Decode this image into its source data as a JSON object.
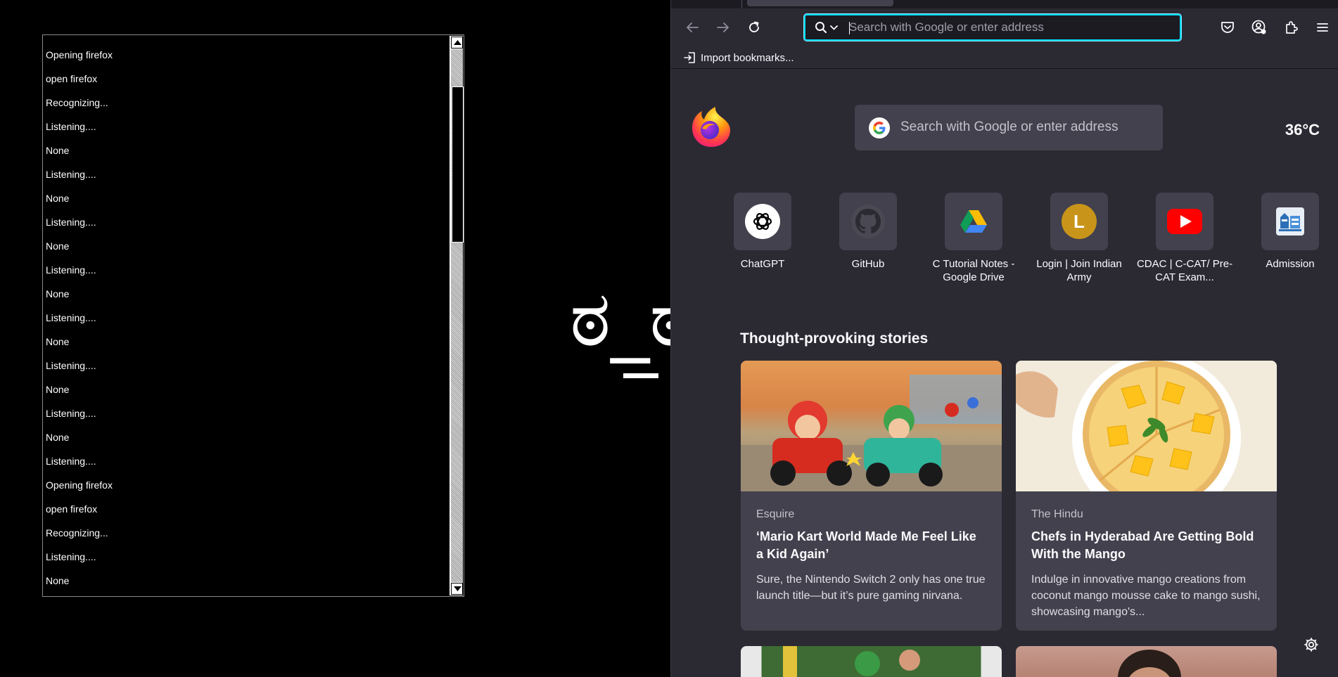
{
  "log_window": {
    "lines": [
      "Opening firefox",
      "open firefox",
      "Recognizing...",
      "Listening....",
      "None",
      "Listening....",
      "None",
      "Listening....",
      "None",
      "Listening....",
      "None",
      "Listening....",
      "None",
      "Listening....",
      "None",
      "Listening....",
      "None",
      "Listening....",
      "Opening firefox",
      "open firefox",
      "Recognizing...",
      "Listening....",
      "None"
    ]
  },
  "background_glyph": "ಠ_ಠ",
  "browser": {
    "url_bar": {
      "placeholder": "Search with Google or enter address",
      "value": ""
    },
    "bookmarks_bar": {
      "import_label": "Import bookmarks..."
    },
    "newtab": {
      "search_placeholder": "Search with Google or enter address",
      "weather": "36°C",
      "shortcuts": [
        {
          "label": "ChatGPT",
          "icon": "chatgpt-icon"
        },
        {
          "label": "GitHub",
          "icon": "github-icon"
        },
        {
          "label": "C Tutorial Notes - Google Drive",
          "icon": "google-drive-icon"
        },
        {
          "label": "Login | Join Indian Army",
          "icon": "letter-l-icon",
          "icon_text": "L"
        },
        {
          "label": "CDAC | C-CAT/ Pre-CAT Exam...",
          "icon": "youtube-icon"
        },
        {
          "label": "Admission",
          "icon": "admission-icon"
        }
      ],
      "stories_heading": "Thought-provoking stories",
      "stories": [
        {
          "source": "Esquire",
          "title": "‘Mario Kart World Made Me Feel Like a Kid Again’",
          "description": "Sure, the Nintendo Switch 2 only has one true launch title—but it’s pure gaming nirvana."
        },
        {
          "source": "The Hindu",
          "title": "Chefs in Hyderabad Are Getting Bold With the Mango",
          "description": "Indulge in innovative mango creations from coconut mango mousse cake to mango sushi, showcasing mango's..."
        }
      ]
    },
    "colors": {
      "background": "#2b2a33",
      "tile": "#42414d",
      "url_focus": "#00ddff",
      "text": "#fbfbfe"
    }
  }
}
